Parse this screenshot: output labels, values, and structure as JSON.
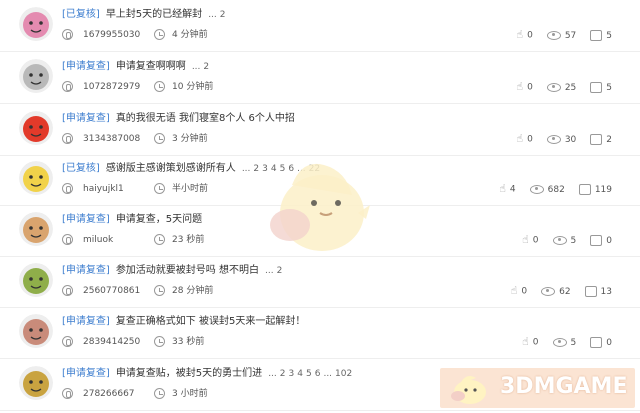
{
  "threads": [
    {
      "tag": "[已复核]",
      "title": "早上封5天的已经解封",
      "pages": [
        "...",
        "2"
      ],
      "author": "1679955030",
      "time": "4 分钟前",
      "likes": "0",
      "views": "57",
      "replies": "5",
      "avatar_color": "#e48bb0"
    },
    {
      "tag": "[申请复查]",
      "title": "申请复查啊啊啊",
      "pages": [
        "...",
        "2"
      ],
      "author": "1072872979",
      "time": "10 分钟前",
      "likes": "0",
      "views": "25",
      "replies": "5",
      "avatar_color": "#b9b9b9"
    },
    {
      "tag": "[申请复查]",
      "title": "真的我很无语 我们寝室8个人 6个人中招",
      "pages": [],
      "author": "3134387008",
      "time": "3 分钟前",
      "likes": "0",
      "views": "30",
      "replies": "2",
      "avatar_color": "#e23a2a"
    },
    {
      "tag": "[已复核]",
      "title": "感谢版主感谢策划感谢所有人",
      "pages": [
        "...",
        "2",
        "3",
        "4",
        "5",
        "6",
        "...",
        "22"
      ],
      "author": "haiyujkl1",
      "time": "半小时前",
      "likes": "4",
      "views": "682",
      "replies": "119",
      "avatar_color": "#f1d24a"
    },
    {
      "tag": "[申请复查]",
      "title": "申请复查，5天问题",
      "pages": [],
      "author": "miluok",
      "time": "23 秒前",
      "likes": "0",
      "views": "5",
      "replies": "0",
      "avatar_color": "#d9a46e"
    },
    {
      "tag": "[申请复查]",
      "title": "参加活动就要被封号吗 想不明白",
      "pages": [
        "...",
        "2"
      ],
      "author": "2560770861",
      "time": "28 分钟前",
      "likes": "0",
      "views": "62",
      "replies": "13",
      "avatar_color": "#8fae4a"
    },
    {
      "tag": "[申请复查]",
      "title": "复查正确格式如下 被误封5天来一起解封！",
      "pages": [],
      "author": "2839414250",
      "time": "33 秒前",
      "likes": "0",
      "views": "5",
      "replies": "0",
      "avatar_color": "#c98b7a"
    },
    {
      "tag": "[申请复查]",
      "title": "申请复查贴，被封5天的勇士们进",
      "pages": [
        "...",
        "2",
        "3",
        "4",
        "5",
        "6",
        "...",
        "102"
      ],
      "author": "278266667",
      "time": "3 小时前",
      "likes": "",
      "views": "",
      "replies": "",
      "avatar_color": "#c9a340"
    }
  ],
  "watermark": {
    "text": "3DMGAME",
    "color": "#fbe4d3"
  }
}
